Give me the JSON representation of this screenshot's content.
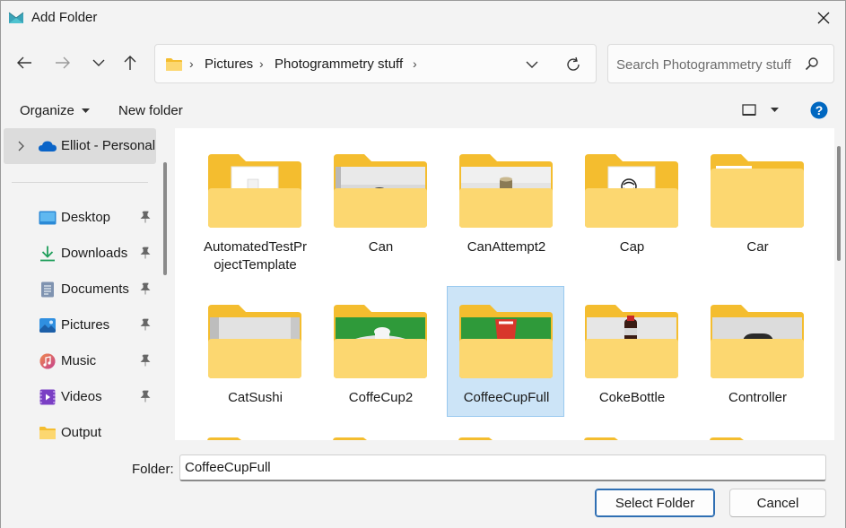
{
  "window": {
    "title": "Add Folder"
  },
  "address": {
    "crumbs": [
      "Pictures",
      "Photogrammetry stuff"
    ]
  },
  "search": {
    "placeholder": "Search Photogrammetry stuff"
  },
  "toolbar": {
    "organize_label": "Organize",
    "new_folder_label": "New folder"
  },
  "sidebar": {
    "onedrive_label": "Elliot - Personal",
    "items": [
      {
        "label": "Desktop",
        "icon": "desktop-icon",
        "pinned": true
      },
      {
        "label": "Downloads",
        "icon": "download-icon",
        "pinned": true
      },
      {
        "label": "Documents",
        "icon": "documents-icon",
        "pinned": true
      },
      {
        "label": "Pictures",
        "icon": "pictures-icon",
        "pinned": true
      },
      {
        "label": "Music",
        "icon": "music-icon",
        "pinned": true
      },
      {
        "label": "Videos",
        "icon": "videos-icon",
        "pinned": true
      },
      {
        "label": "Output",
        "icon": "folder-icon",
        "pinned": false
      }
    ]
  },
  "folders": [
    {
      "name": "AutomatedTestProjectTemplate",
      "line1": "AutomatedTestPr",
      "line2": "ojectTemplate",
      "thumb": "document",
      "selected": false
    },
    {
      "name": "Can",
      "line1": "Can",
      "line2": "",
      "thumb": "photo-can",
      "selected": false
    },
    {
      "name": "CanAttempt2",
      "line1": "CanAttempt2",
      "line2": "",
      "thumb": "photo-can2",
      "selected": false
    },
    {
      "name": "Cap",
      "line1": "Cap",
      "line2": "",
      "thumb": "document-logo",
      "selected": false
    },
    {
      "name": "Car",
      "line1": "Car",
      "line2": "",
      "thumb": "empty",
      "selected": false
    },
    {
      "name": "CatSushi",
      "line1": "CatSushi",
      "line2": "",
      "thumb": "photo-sushi",
      "selected": false
    },
    {
      "name": "CoffeCup2",
      "line1": "CoffeCup2",
      "line2": "",
      "thumb": "photo-green",
      "selected": false
    },
    {
      "name": "CoffeeCupFull",
      "line1": "CoffeeCupFull",
      "line2": "",
      "thumb": "photo-green-cup",
      "selected": true
    },
    {
      "name": "CokeBottle",
      "line1": "CokeBottle",
      "line2": "",
      "thumb": "photo-coke",
      "selected": false
    },
    {
      "name": "Controller",
      "line1": "Controller",
      "line2": "",
      "thumb": "photo-controller",
      "selected": false
    }
  ],
  "bottom": {
    "folder_label": "Folder:",
    "folder_value": "CoffeeCupFull",
    "select_label": "Select Folder",
    "cancel_label": "Cancel"
  },
  "colors": {
    "accent": "#0067c0",
    "selection": "#cce4f7",
    "folder_back": "#f4bd2f",
    "folder_front": "#fcd770"
  }
}
